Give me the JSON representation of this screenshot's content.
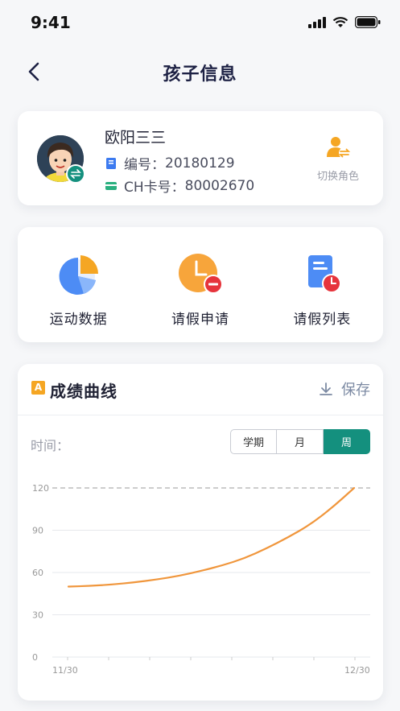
{
  "status": {
    "time": "9:41"
  },
  "nav": {
    "title": "孩子信息"
  },
  "profile": {
    "name": "欧阳三三",
    "id_label": "编号：",
    "id_value": "20180129",
    "card_label": "CH卡号：",
    "card_value": "80002670",
    "switch_label": "切换角色"
  },
  "actions": [
    {
      "label": "运动数据",
      "icon": "pie-chart-icon"
    },
    {
      "label": "请假申请",
      "icon": "clock-minus-icon"
    },
    {
      "label": "请假列表",
      "icon": "document-clock-icon"
    }
  ],
  "curve": {
    "title": "成绩曲线",
    "title_icon_text": "A",
    "save_label": "保存",
    "time_label": "时间：",
    "tabs": [
      "学期",
      "月",
      "周"
    ],
    "active_tab": "周"
  },
  "colors": {
    "accent": "#14907e",
    "line": "#f0963c",
    "title": "#1d2144"
  },
  "chart_data": {
    "type": "line",
    "title": "",
    "xlabel": "",
    "ylabel": "",
    "x_tick_labels": [
      "11/30",
      "12/30"
    ],
    "y_ticks": [
      0,
      30,
      60,
      90,
      120
    ],
    "ylim": [
      0,
      120
    ],
    "x": [
      "11/30",
      "12/30"
    ],
    "series": [
      {
        "values": [
          50,
          50.5,
          51.5,
          53,
          55,
          57.5,
          61,
          65,
          70,
          77,
          85,
          94,
          106,
          120
        ]
      }
    ],
    "reference_line": 120,
    "grid": true
  }
}
